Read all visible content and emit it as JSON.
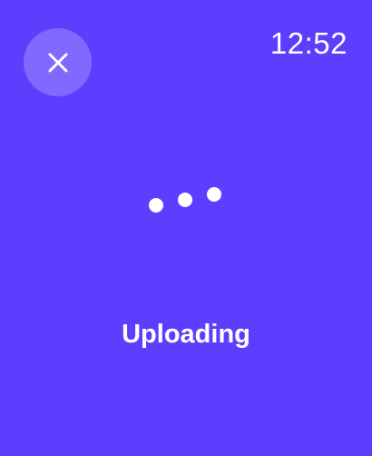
{
  "header": {
    "time": "12:52",
    "close_icon": "close-icon"
  },
  "main": {
    "status_text": "Uploading",
    "loader_icon": "loading-dots-icon"
  },
  "colors": {
    "background": "#5c3ffe",
    "foreground": "#ffffff",
    "close_button_bg": "#ffffff38"
  }
}
